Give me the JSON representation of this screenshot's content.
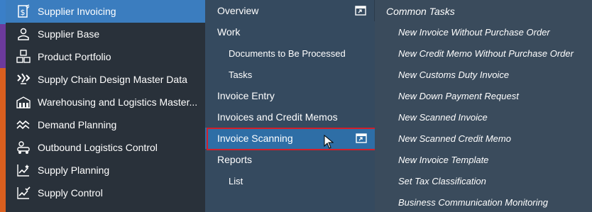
{
  "sidebar": {
    "items": [
      {
        "label": "Supplier Invoicing",
        "icon": "invoice-dollar-icon",
        "active": true
      },
      {
        "label": "Supplier Base",
        "icon": "supplier-person-icon"
      },
      {
        "label": "Product Portfolio",
        "icon": "product-cubes-icon"
      },
      {
        "label": "Supply Chain Design Master Data",
        "icon": "supply-chain-icon"
      },
      {
        "label": "Warehousing and Logistics Master...",
        "icon": "warehouse-icon"
      },
      {
        "label": "Demand Planning",
        "icon": "demand-wave-icon"
      },
      {
        "label": "Outbound Logistics Control",
        "icon": "truck-icon"
      },
      {
        "label": "Supply Planning",
        "icon": "planning-chart-icon"
      },
      {
        "label": "Supply Control",
        "icon": "control-chart-icon"
      }
    ]
  },
  "middle": {
    "overview": "Overview",
    "work": "Work",
    "documents": "Documents to Be Processed",
    "tasks": "Tasks",
    "invoice_entry": "Invoice Entry",
    "invoices_credit": "Invoices and Credit Memos",
    "invoice_scanning": "Invoice Scanning",
    "reports": "Reports",
    "list": "List"
  },
  "right": {
    "title": "Common Tasks",
    "items": [
      "New Invoice Without Purchase Order",
      "New Credit Memo Without Purchase Order",
      "New Customs Duty Invoice",
      "New Down Payment Request",
      "New Scanned Invoice",
      "New Scanned Credit Memo",
      "New Invoice Template",
      "Set Tax Classification",
      "Business Communication Monitoring"
    ]
  }
}
